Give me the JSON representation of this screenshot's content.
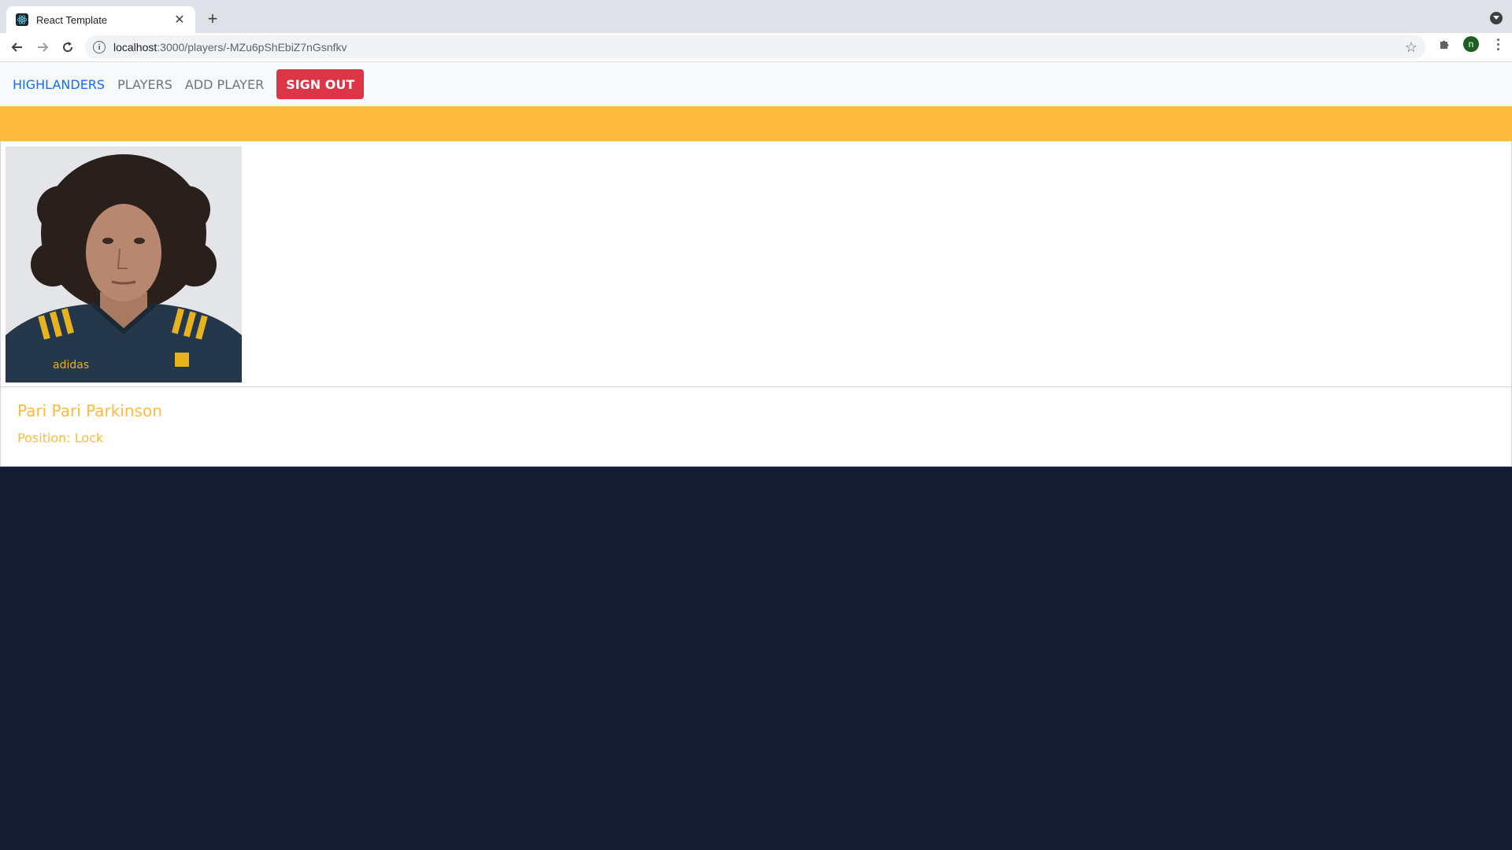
{
  "browser": {
    "tab_title": "React Template",
    "url_host": "localhost",
    "url_rest": ":3000/players/-MZu6pShEbiZ7nGsnfkv",
    "profile_initial": "n"
  },
  "navbar": {
    "brand": "HIGHLANDERS",
    "links": [
      "PLAYERS",
      "ADD PLAYER"
    ],
    "signout": "SIGN OUT"
  },
  "player": {
    "name": "Pari Pari Parkinson",
    "position_label": "Position:",
    "position_value": "Lock",
    "jersey_brand": "adidas"
  },
  "colors": {
    "brand_blue": "#0d6efd",
    "accent_gold": "#fdba3f",
    "danger_red": "#dc3545",
    "page_navy": "#141d31"
  }
}
